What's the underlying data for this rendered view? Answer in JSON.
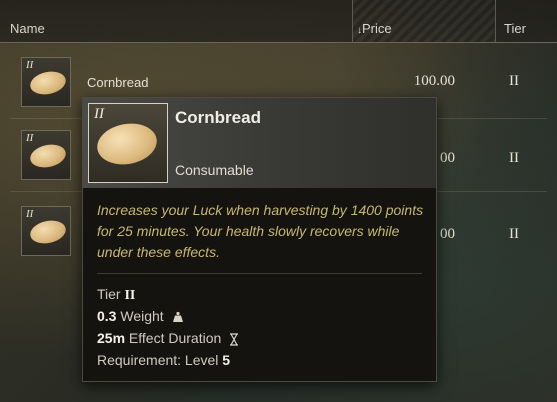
{
  "header": {
    "name_label": "Name",
    "price_label": "Price",
    "tier_label": "Tier",
    "sort_icon": "sort-desc-icon"
  },
  "rows": [
    {
      "tier_badge": "II",
      "name": "Cornbread",
      "price": "100.00",
      "tier": "II"
    },
    {
      "tier_badge": "II",
      "name": "",
      "price": "00",
      "tier": "II"
    },
    {
      "tier_badge": "II",
      "name": "",
      "price": "00",
      "tier": "II"
    }
  ],
  "tooltip": {
    "tier_badge": "II",
    "title": "Cornbread",
    "type": "Consumable",
    "description": "Increases your Luck when harvesting by 1400 points for 25 minutes. Your health slowly recovers while under these effects.",
    "tier_label": "Tier",
    "tier_value": "II",
    "weight_value": "0.3",
    "weight_label": "Weight",
    "weight_icon": "weight-icon",
    "duration_value": "25m",
    "duration_label": "Effect Duration",
    "duration_icon": "hourglass-icon",
    "requirement_label": "Requirement: Level",
    "requirement_value": "5"
  },
  "colors": {
    "description": "#c9b870",
    "header_line": "#6b675a"
  }
}
